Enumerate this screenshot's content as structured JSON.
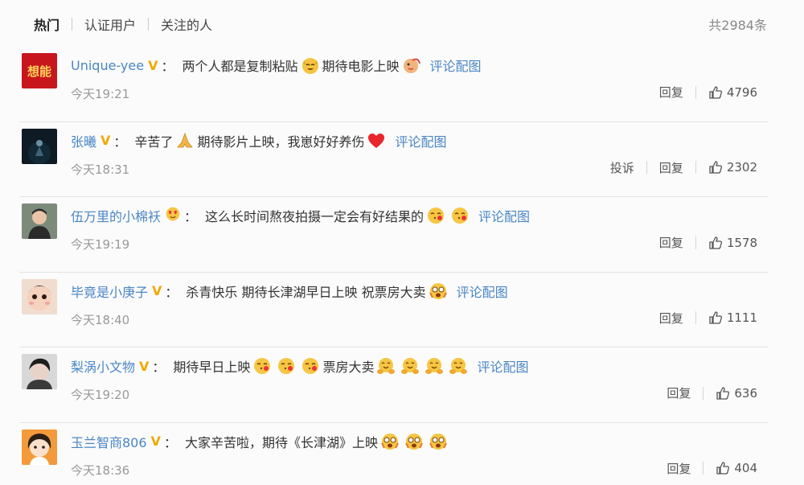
{
  "tabs": [
    {
      "label": "热门",
      "active": true
    },
    {
      "label": "认证用户",
      "active": false
    },
    {
      "label": "关注的人",
      "active": false
    }
  ],
  "total_label": "共2984条",
  "avatar_text_0": "想能",
  "comments": [
    {
      "user": "Unique-yee",
      "badge": "V",
      "colon": "：",
      "text_parts": [
        "两个人都是复制粘贴",
        "期待电影上映"
      ],
      "pic_link": "评论配图",
      "time": "今天19:21",
      "report": "",
      "reply": "回复",
      "likes": "4796"
    },
    {
      "user": "张曦",
      "badge": "V",
      "colon": "：",
      "text_parts": [
        "辛苦了",
        "期待影片上映，我崽好好养伤"
      ],
      "pic_link": "评论配图",
      "time": "今天18:31",
      "report": "投诉",
      "reply": "回复",
      "likes": "2302"
    },
    {
      "user": "伍万里的小棉袄",
      "badge": "",
      "colon": "：",
      "text_parts": [
        "这么长时间熬夜拍摄一定会有好结果的"
      ],
      "pic_link": "评论配图",
      "time": "今天19:19",
      "report": "",
      "reply": "回复",
      "likes": "1578"
    },
    {
      "user": "毕竟是小庚子",
      "badge": "V",
      "colon": "：",
      "text_parts": [
        "杀青快乐 期待长津湖早日上映 祝票房大卖"
      ],
      "pic_link": "评论配图",
      "time": "今天18:40",
      "report": "",
      "reply": "回复",
      "likes": "1111"
    },
    {
      "user": "梨涡小文物",
      "badge": "V",
      "colon": "：",
      "text_parts": [
        "期待早日上映",
        "票房大卖"
      ],
      "pic_link": "评论配图",
      "time": "今天19:20",
      "report": "",
      "reply": "回复",
      "likes": "636"
    },
    {
      "user": "玉兰智商806",
      "badge": "V",
      "colon": "：",
      "text_parts": [
        "大家辛苦啦，期待《长津湖》上映"
      ],
      "pic_link": "",
      "time": "今天18:36",
      "report": "",
      "reply": "回复",
      "likes": "404"
    }
  ],
  "icons": {
    "like": "thumbs-up-icon",
    "verified": "v-badge-icon",
    "emoji_laugh": "laughing-dog-emoji",
    "emoji_pray": "pray-emoji",
    "emoji_heart": "red-heart-emoji",
    "emoji_love": "heart-eyes-emoji",
    "emoji_kiss": "kiss-emoji",
    "emoji_hug": "hug-emoji",
    "emoji_wow": "wow-emoji"
  },
  "colors": {
    "username_orange": "#eb7350",
    "username_blue": "#4a86c5",
    "link_blue": "#4a86c5",
    "verified_gold": "#f0a800",
    "time_gray": "#999999"
  }
}
